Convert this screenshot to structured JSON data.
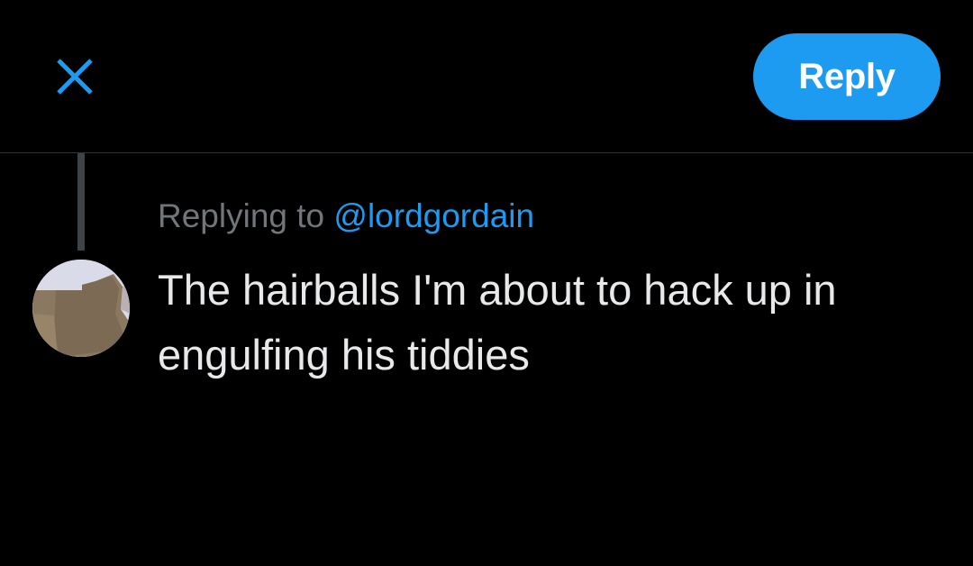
{
  "header": {
    "close_icon": "close-icon",
    "reply_label": "Reply"
  },
  "compose": {
    "replying_label": "Replying to",
    "replying_to_handle": "@lordgordain",
    "text": "The hairballs I'm about to hack up in engulfing his tiddies"
  },
  "colors": {
    "background": "#000000",
    "accent": "#1d9bf0",
    "close_icon": "#1d9bf0",
    "divider": "#2f3336",
    "thread_line": "#3d4347",
    "muted_text": "#71767b",
    "body_text": "#e7e9ea",
    "button_text": "#ffffff"
  }
}
